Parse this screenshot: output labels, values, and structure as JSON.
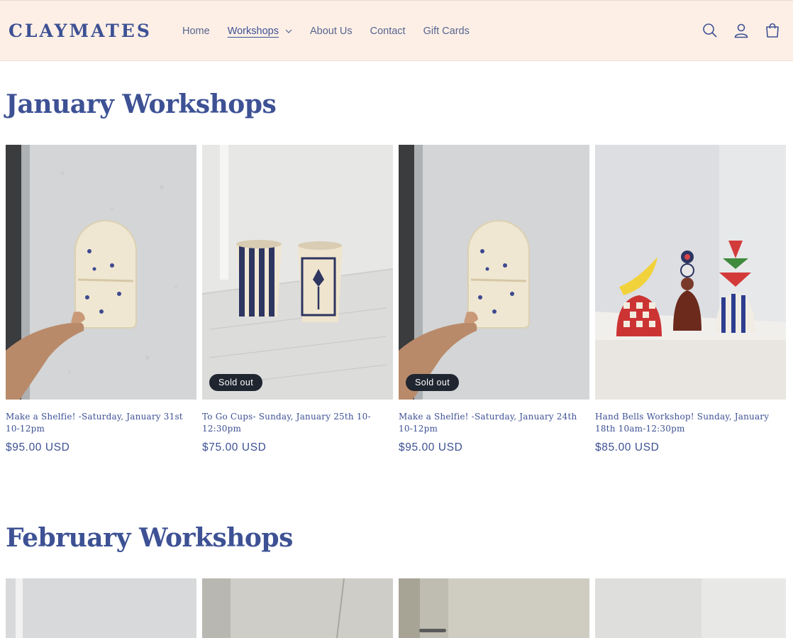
{
  "header": {
    "logo": "CLAYMATES",
    "nav": [
      {
        "label": "Home"
      },
      {
        "label": "Workshops"
      },
      {
        "label": "About Us"
      },
      {
        "label": "Contact"
      },
      {
        "label": "Gift Cards"
      }
    ],
    "icons": [
      "search-icon",
      "account-icon",
      "cart-icon"
    ]
  },
  "january": {
    "title": "January Workshops",
    "products": [
      {
        "title": "Make a Shelfie! -Saturday, January 31st 10-12pm",
        "price": "$95.00 USD",
        "badge": ""
      },
      {
        "title": "To Go Cups- Sunday, January 25th 10-12:30pm",
        "price": "$75.00 USD",
        "badge": "Sold out"
      },
      {
        "title": "Make a Shelfie! -Saturday, January 24th 10-12pm",
        "price": "$95.00 USD",
        "badge": "Sold out"
      },
      {
        "title": "Hand Bells Workshop! Sunday, January 18th 10am-12:30pm",
        "price": "$85.00 USD",
        "badge": ""
      }
    ]
  },
  "february": {
    "title": "February Workshops"
  },
  "colors": {
    "brand": "#3d5194",
    "header_bg": "#fdefe6",
    "badge_bg": "#1f2630"
  }
}
